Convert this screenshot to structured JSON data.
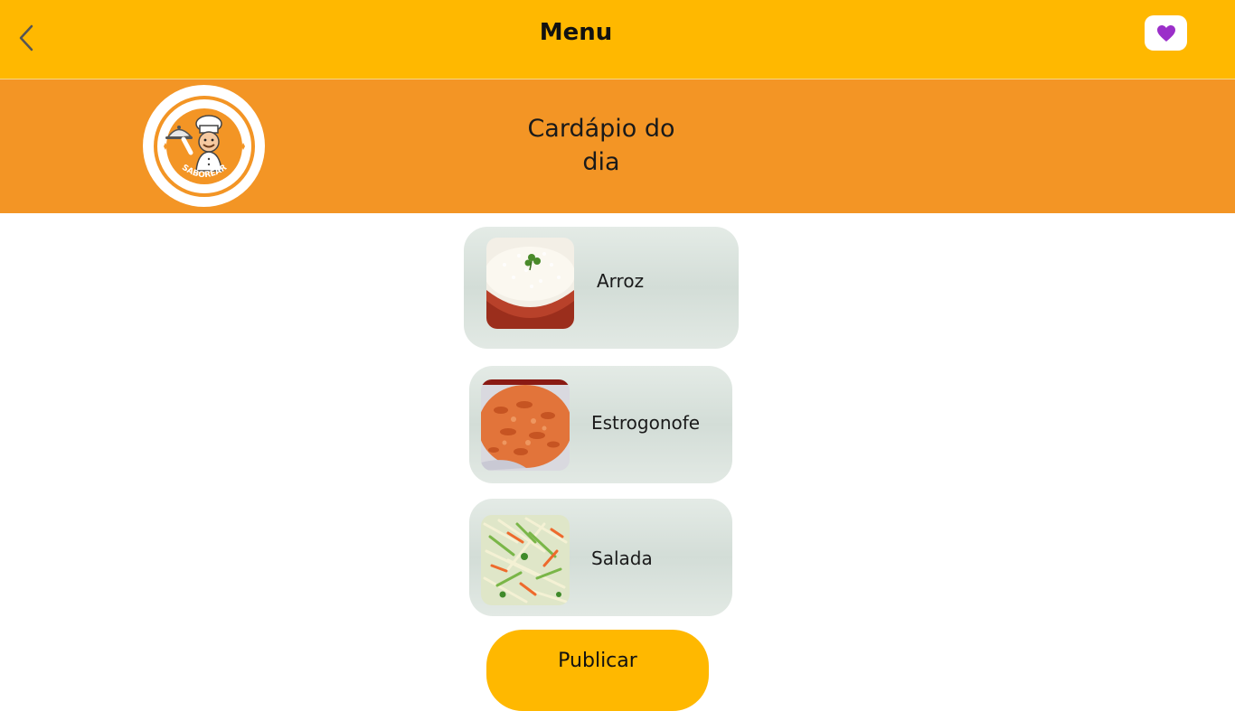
{
  "header": {
    "title": "Menu",
    "back_icon": "chevron-left-icon",
    "favorite_icon": "purple-heart-icon",
    "background": "#FFB800"
  },
  "banner": {
    "title": "Cardápio do dia",
    "logo_text": "SABOREAR",
    "background": "#F39525"
  },
  "menu": {
    "items": [
      {
        "label": "Arroz"
      },
      {
        "label": "Estrogonofe"
      },
      {
        "label": "Salada"
      }
    ]
  },
  "actions": {
    "publish_label": "Publicar"
  },
  "colors": {
    "accent_yellow": "#FFB800",
    "accent_orange": "#F39525",
    "card_bg": "#DDE5E0",
    "heart": "#9B2FC9"
  }
}
